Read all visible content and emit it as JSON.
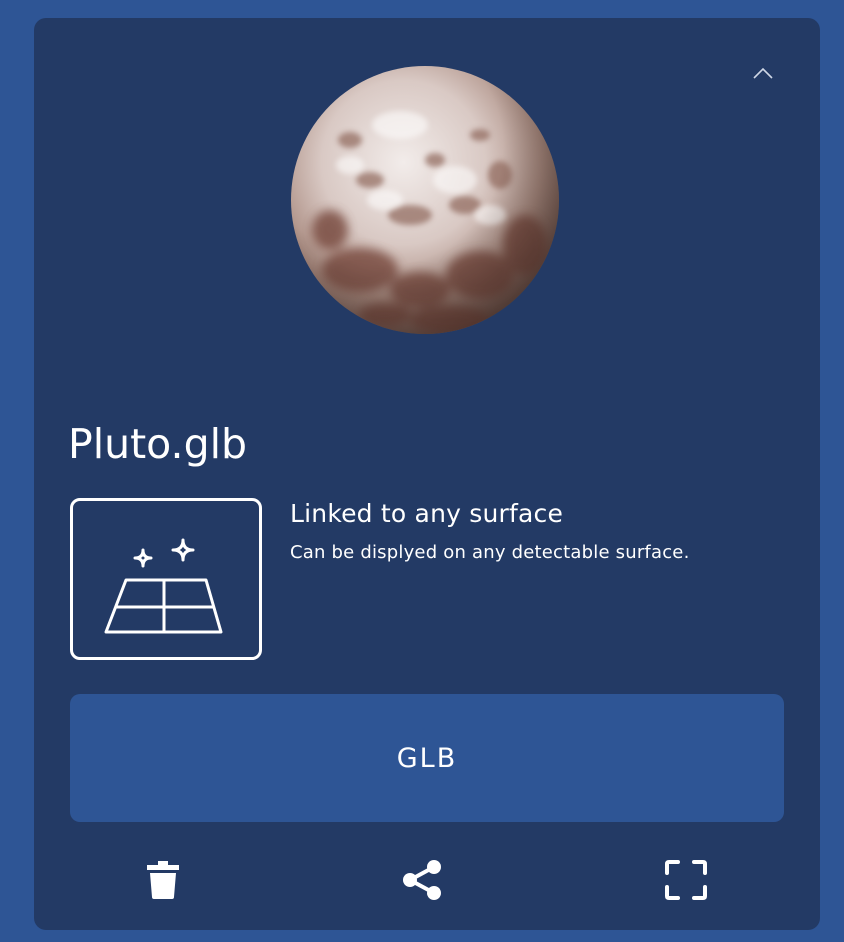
{
  "model": {
    "title": "Pluto.glb"
  },
  "placement": {
    "heading": "Linked to any surface",
    "description": "Can be displyed on any detectable surface."
  },
  "format_button": {
    "label": "GLB"
  },
  "icons": {
    "collapse": "chevron-up-icon",
    "placement": "surface-sparkle-icon",
    "delete": "trash-icon",
    "share": "share-icon",
    "fullscreen": "fullscreen-icon"
  },
  "colors": {
    "background": "#2e5595",
    "card": "#233a65",
    "button": "#2e5595",
    "text": "#ffffff"
  }
}
